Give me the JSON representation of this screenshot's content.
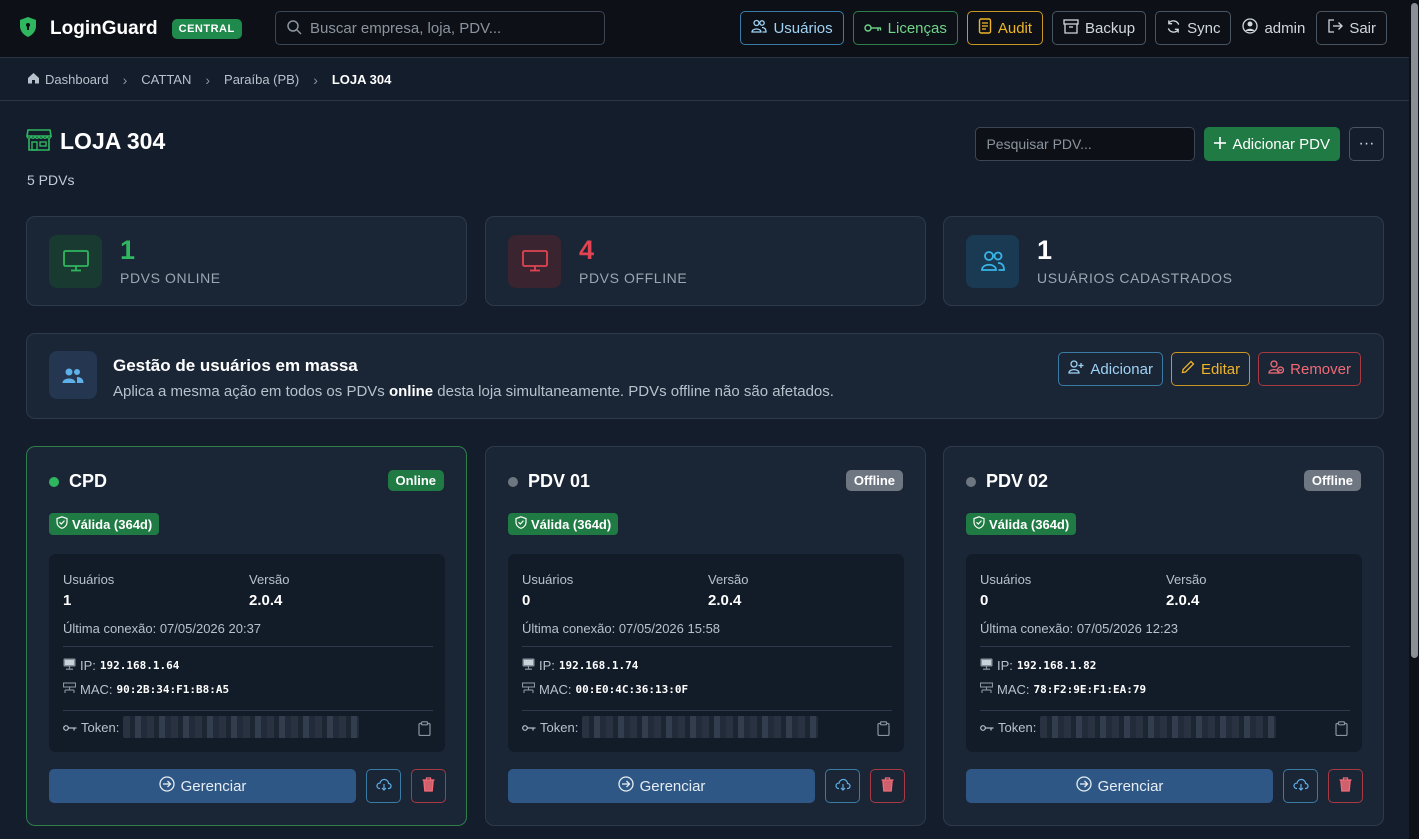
{
  "navbar": {
    "brand": "LoginGuard",
    "badge": "CENTRAL",
    "search_placeholder": "Buscar empresa, loja, PDV...",
    "buttons": {
      "users": "Usuários",
      "licenses": "Licenças",
      "audit": "Audit",
      "backup": "Backup",
      "sync": "Sync",
      "admin": "admin",
      "logout": "Sair"
    }
  },
  "breadcrumb": [
    "Dashboard",
    "CATTAN",
    "Paraíba (PB)",
    "LOJA 304"
  ],
  "page": {
    "title": "LOJA 304",
    "subtitle": "5 PDVs",
    "pdv_search_placeholder": "Pesquisar PDV...",
    "add_button": "Adicionar PDV",
    "more_button": "···"
  },
  "stats": [
    {
      "value": "1",
      "label": "PDVS ONLINE"
    },
    {
      "value": "4",
      "label": "PDVS OFFLINE"
    },
    {
      "value": "1",
      "label": "USUÁRIOS CADASTRADOS"
    }
  ],
  "bulk": {
    "title": "Gestão de usuários em massa",
    "desc_before": "Aplica a mesma ação em todos os PDVs ",
    "desc_bold": "online",
    "desc_after": " desta loja simultaneamente. PDVs offline não são afetados.",
    "add": "Adicionar",
    "edit": "Editar",
    "remove": "Remover"
  },
  "labels": {
    "users": "Usuários",
    "version": "Versão",
    "last_conn_prefix": "Última conexão: ",
    "ip": "IP:",
    "mac": "MAC:",
    "token": "Token:",
    "manage": "Gerenciar"
  },
  "cards": [
    {
      "name": "CPD",
      "status": "Online",
      "license": "Válida (364d)",
      "users": "1",
      "version": "2.0.4",
      "last_conn": "07/05/2026 20:37",
      "ip": "192.168.1.64",
      "mac": "90:2B:34:F1:B8:A5"
    },
    {
      "name": "PDV 01",
      "status": "Offline",
      "license": "Válida (364d)",
      "users": "0",
      "version": "2.0.4",
      "last_conn": "07/05/2026 15:58",
      "ip": "192.168.1.74",
      "mac": "00:E0:4C:36:13:0F"
    },
    {
      "name": "PDV 02",
      "status": "Offline",
      "license": "Válida (364d)",
      "users": "0",
      "version": "2.0.4",
      "last_conn": "07/05/2026 12:23",
      "ip": "192.168.1.82",
      "mac": "78:F2:9E:F1:EA:79"
    }
  ],
  "colors": {
    "online": "#2fb760",
    "offline": "#e04452",
    "users": "#38b5e8",
    "card_online_badge": "#1f7a43",
    "card_offline_badge": "#6e7681"
  }
}
